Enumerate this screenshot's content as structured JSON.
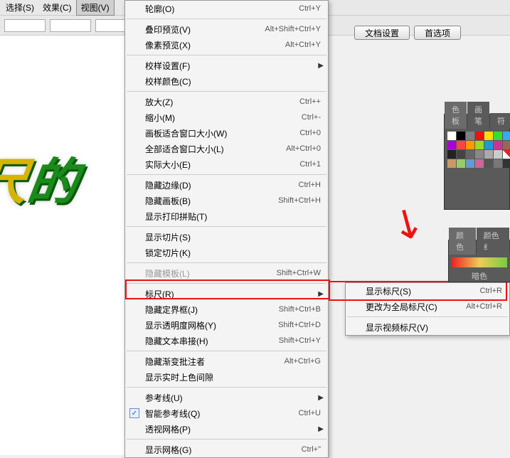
{
  "menubar": {
    "select": "选择(S)",
    "effect": "效果(C)",
    "view": "视图(V)"
  },
  "toolbar": {
    "doc_settings": "文档设置",
    "preferences": "首选项"
  },
  "canvas": {
    "text_r": "尺",
    "text_g": "的"
  },
  "menu": [
    {
      "label": "轮廓(O)",
      "shortcut": "Ctrl+Y"
    },
    {
      "sep": true
    },
    {
      "label": "叠印预览(V)",
      "shortcut": "Alt+Shift+Ctrl+Y"
    },
    {
      "label": "像素预览(X)",
      "shortcut": "Alt+Ctrl+Y"
    },
    {
      "sep": true
    },
    {
      "label": "校样设置(F)",
      "sub": true
    },
    {
      "label": "校样颜色(C)"
    },
    {
      "sep": true
    },
    {
      "label": "放大(Z)",
      "shortcut": "Ctrl++"
    },
    {
      "label": "缩小(M)",
      "shortcut": "Ctrl+-"
    },
    {
      "label": "画板适合窗口大小(W)",
      "shortcut": "Ctrl+0"
    },
    {
      "label": "全部适合窗口大小(L)",
      "shortcut": "Alt+Ctrl+0"
    },
    {
      "label": "实际大小(E)",
      "shortcut": "Ctrl+1"
    },
    {
      "sep": true
    },
    {
      "label": "隐藏边缘(D)",
      "shortcut": "Ctrl+H"
    },
    {
      "label": "隐藏画板(B)",
      "shortcut": "Shift+Ctrl+H"
    },
    {
      "label": "显示打印拼贴(T)"
    },
    {
      "sep": true
    },
    {
      "label": "显示切片(S)"
    },
    {
      "label": "锁定切片(K)"
    },
    {
      "sep": true
    },
    {
      "label": "隐藏模板(L)",
      "shortcut": "Shift+Ctrl+W",
      "disabled": true
    },
    {
      "sep": true
    },
    {
      "label": "标尺(R)",
      "sub": true
    },
    {
      "label": "隐藏定界框(J)",
      "shortcut": "Shift+Ctrl+B"
    },
    {
      "label": "显示透明度网格(Y)",
      "shortcut": "Shift+Ctrl+D"
    },
    {
      "label": "隐藏文本串接(H)",
      "shortcut": "Shift+Ctrl+Y"
    },
    {
      "sep": true
    },
    {
      "label": "隐藏渐变批注者",
      "shortcut": "Alt+Ctrl+G"
    },
    {
      "label": "显示实时上色间隙"
    },
    {
      "sep": true
    },
    {
      "label": "参考线(U)",
      "sub": true
    },
    {
      "label": "智能参考线(Q)",
      "shortcut": "Ctrl+U",
      "checked": true
    },
    {
      "label": "透视网格(P)",
      "sub": true
    },
    {
      "sep": true
    },
    {
      "label": "显示网格(G)",
      "shortcut": "Ctrl+\""
    }
  ],
  "submenu": [
    {
      "label": "显示标尺(S)",
      "shortcut": "Ctrl+R"
    },
    {
      "label": "更改为全局标尺(C)",
      "shortcut": "Alt+Ctrl+R"
    },
    {
      "sep": true
    },
    {
      "label": "显示视频标尺(V)"
    }
  ],
  "swatch_tabs": {
    "t1": "色板",
    "t2": "画笔",
    "t3": "符"
  },
  "color_tabs": {
    "t1": "颜色",
    "t2": "颜色纟"
  },
  "swatch_text": "暗色"
}
